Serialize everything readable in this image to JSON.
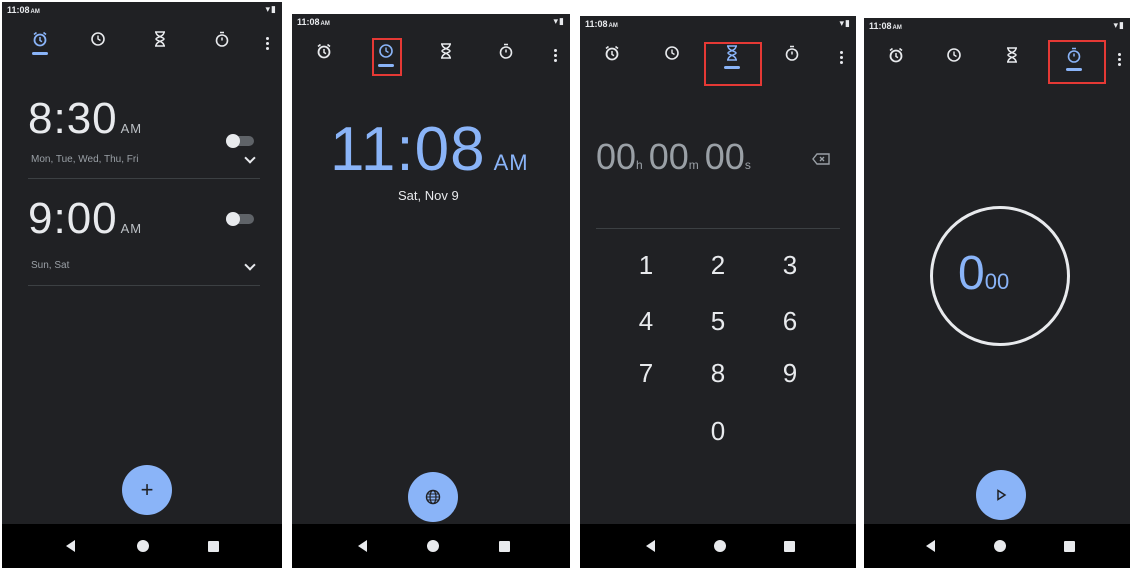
{
  "status": {
    "time": "11:08",
    "time_suffix": "AM"
  },
  "tabs": [
    {
      "name": "alarm",
      "icon": "alarm-icon"
    },
    {
      "name": "clock",
      "icon": "clock-icon"
    },
    {
      "name": "timer",
      "icon": "hourglass-icon"
    },
    {
      "name": "stopwatch",
      "icon": "stopwatch-icon"
    }
  ],
  "alarm_screen": {
    "alarms": [
      {
        "time": "8:30",
        "ampm": "AM",
        "days": "Mon, Tue, Wed, Thu, Fri",
        "enabled": false
      },
      {
        "time": "9:00",
        "ampm": "AM",
        "days": "Sun, Sat",
        "enabled": false
      }
    ],
    "fab_label": "+"
  },
  "clock_screen": {
    "time": "11:08",
    "ampm": "AM",
    "date": "Sat, Nov 9"
  },
  "timer_screen": {
    "hours": "00",
    "hours_unit": "h",
    "minutes": "00",
    "minutes_unit": "m",
    "seconds": "00",
    "seconds_unit": "s",
    "keypad": [
      "1",
      "2",
      "3",
      "4",
      "5",
      "6",
      "7",
      "8",
      "9",
      "0"
    ]
  },
  "stopwatch_screen": {
    "seconds": "0",
    "hundredths": "00"
  },
  "colors": {
    "background": "#202124",
    "accent": "#8ab4f8",
    "highlight_box": "#e53935"
  }
}
